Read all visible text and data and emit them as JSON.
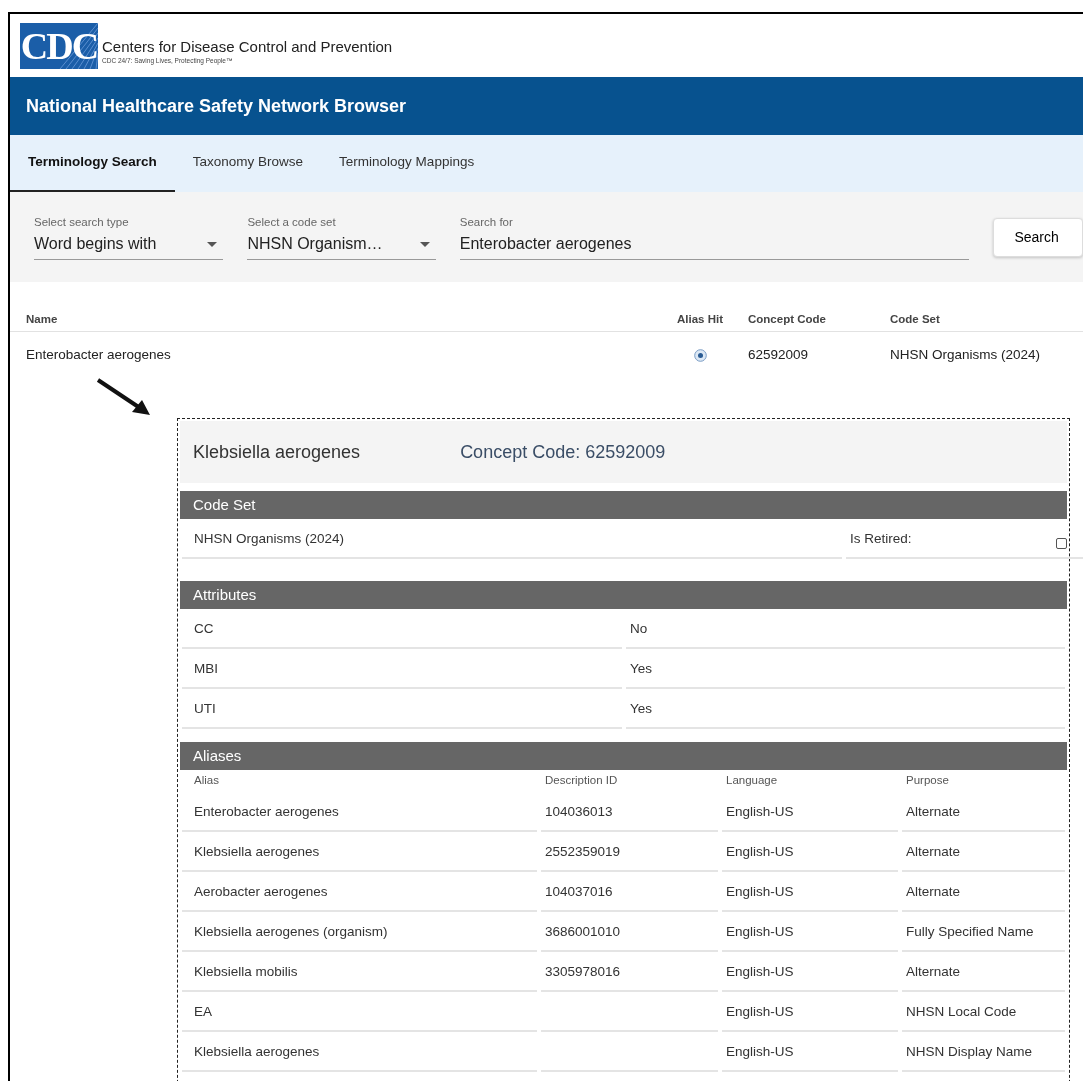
{
  "header": {
    "logo_text": "CDC",
    "org_name": "Centers for Disease Control and Prevention",
    "tagline": "CDC 24/7: Saving Lives, Protecting People™"
  },
  "app_title": "National Healthcare Safety Network Browser",
  "tabs": [
    {
      "label": "Terminology Search",
      "selected": true
    },
    {
      "label": "Taxonomy Browse",
      "selected": false
    },
    {
      "label": "Terminology Mappings",
      "selected": false
    }
  ],
  "search": {
    "fields": [
      {
        "kind": "select",
        "label": "Select search type",
        "value": "Word begins with"
      },
      {
        "kind": "select",
        "label": "Select a code set",
        "value": "NHSN Organism…"
      },
      {
        "kind": "text",
        "label": "Search for",
        "value": "Enterobacter aerogenes"
      }
    ],
    "button": "Search"
  },
  "results": {
    "columns": [
      "Name",
      "Alias Hit",
      "Concept Code",
      "Code Set"
    ],
    "rows": [
      {
        "name": "Enterobacter aerogenes",
        "alias_hit": true,
        "concept_code": "62592009",
        "code_set": "NHSN Organisms (2024)"
      }
    ]
  },
  "detail": {
    "title": "Klebsiella aerogenes",
    "concept_code": "Concept Code: 62592009",
    "code_set": {
      "heading": "Code Set",
      "value": "NHSN Organisms (2024)",
      "retired_label": "Is Retired:",
      "retired": false
    },
    "attributes": {
      "heading": "Attributes",
      "rows": [
        {
          "name": "CC",
          "value": "No"
        },
        {
          "name": "MBI",
          "value": "Yes"
        },
        {
          "name": "UTI",
          "value": "Yes"
        }
      ]
    },
    "aliases": {
      "heading": "Aliases",
      "columns": [
        "Alias",
        "Description ID",
        "Language",
        "Purpose"
      ],
      "rows": [
        [
          "Enterobacter aerogenes",
          "104036013",
          "English-US",
          "Alternate"
        ],
        [
          "Klebsiella aerogenes",
          "2552359019",
          "English-US",
          "Alternate"
        ],
        [
          "Aerobacter aerogenes",
          "104037016",
          "English-US",
          "Alternate"
        ],
        [
          "Klebsiella aerogenes (organism)",
          "3686001010",
          "English-US",
          "Fully Specified Name"
        ],
        [
          "Klebsiella mobilis",
          "3305978016",
          "English-US",
          "Alternate"
        ],
        [
          "EA",
          "",
          "English-US",
          "NHSN Local Code"
        ],
        [
          "Klebsiella aerogenes",
          "",
          "English-US",
          "NHSN Display Name"
        ]
      ]
    }
  }
}
